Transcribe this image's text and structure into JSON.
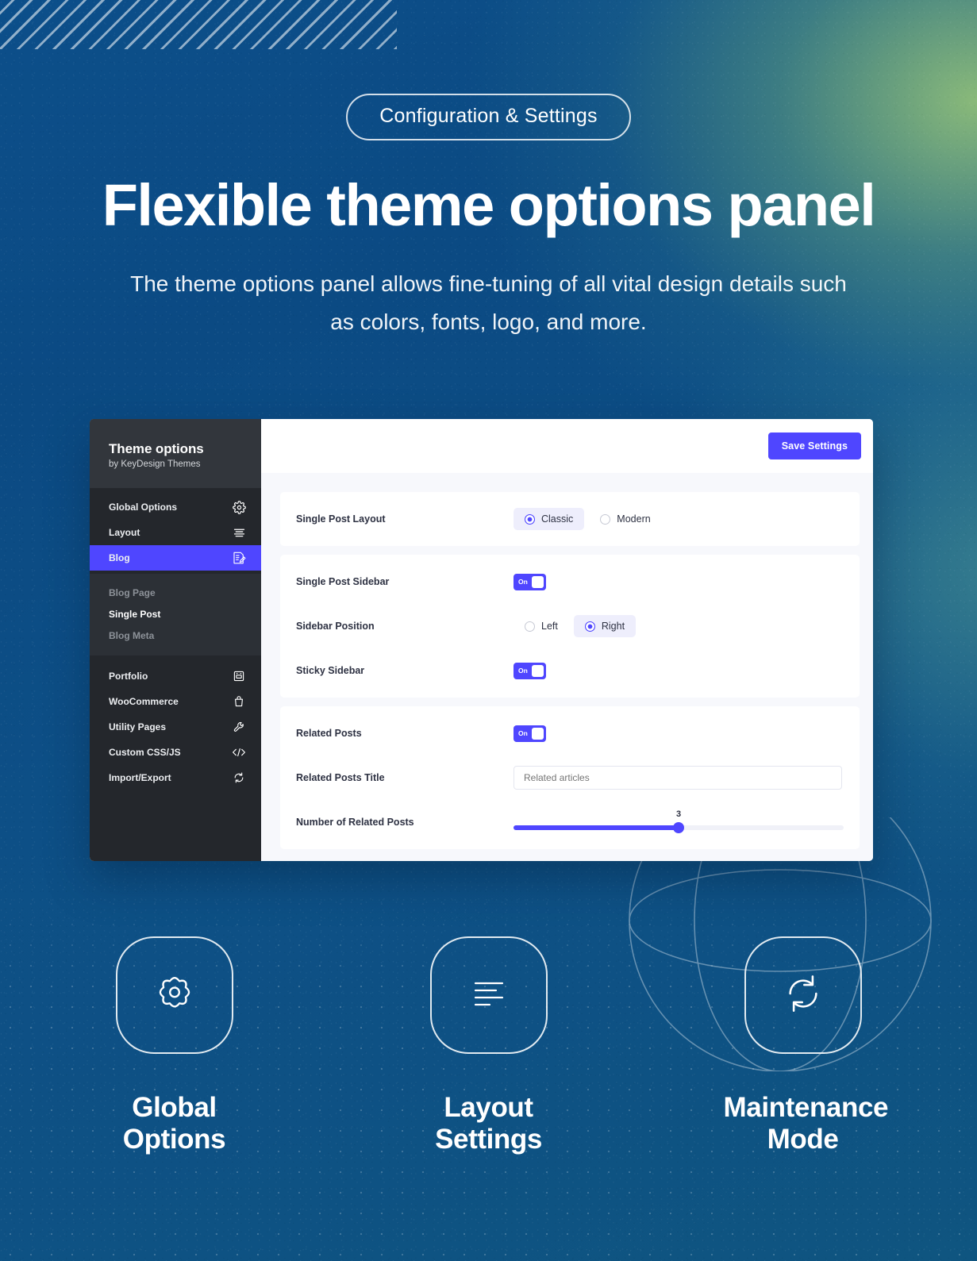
{
  "hero": {
    "badge": "Configuration & Settings",
    "headline": "Flexible theme options panel",
    "subhead": "The theme options panel allows fine-tuning of all vital design details such as colors, fonts, logo, and more."
  },
  "panel": {
    "sidebar": {
      "title": "Theme options",
      "subtitle": "by KeyDesign Themes",
      "primary_items": [
        {
          "label": "Global Options",
          "icon": "gear-icon",
          "active": false
        },
        {
          "label": "Layout",
          "icon": "align-lines-icon",
          "active": false
        },
        {
          "label": "Blog",
          "icon": "edit-document-icon",
          "active": true
        }
      ],
      "sub_items": [
        {
          "label": "Blog Page",
          "current": false
        },
        {
          "label": "Single Post",
          "current": true
        },
        {
          "label": "Blog Meta",
          "current": false
        }
      ],
      "secondary_items": [
        {
          "label": "Portfolio",
          "icon": "portfolio-grid-icon"
        },
        {
          "label": "WooCommerce",
          "icon": "shopping-bag-icon"
        },
        {
          "label": "Utility Pages",
          "icon": "wrench-icon"
        },
        {
          "label": "Custom CSS/JS",
          "icon": "code-brackets-icon"
        },
        {
          "label": "Import/Export",
          "icon": "sync-arrows-icon"
        }
      ],
      "active_color": "#4f46ff",
      "background": "#24272c",
      "header_background": "#32363c"
    },
    "toolbar": {
      "save_label": "Save Settings"
    },
    "settings": {
      "single_post_layout": {
        "label": "Single Post Layout",
        "options": [
          "Classic",
          "Modern"
        ],
        "selected": "Classic"
      },
      "single_post_sidebar": {
        "label": "Single Post Sidebar",
        "toggle_label": "On",
        "value": true
      },
      "sidebar_position": {
        "label": "Sidebar Position",
        "options": [
          "Left",
          "Right"
        ],
        "selected": "Right"
      },
      "sticky_sidebar": {
        "label": "Sticky Sidebar",
        "toggle_label": "On",
        "value": true
      },
      "related_posts": {
        "label": "Related Posts",
        "toggle_label": "On",
        "value": true
      },
      "related_posts_title": {
        "label": "Related Posts Title",
        "placeholder": "Related articles",
        "value": ""
      },
      "number_of_related_posts": {
        "label": "Number of Related Posts",
        "value": "3",
        "percent": 50
      }
    }
  },
  "features": [
    {
      "label": "Global\nOptions",
      "icon": "gear-outline-icon"
    },
    {
      "label": "Layout\nSettings",
      "icon": "align-left-outline-icon"
    },
    {
      "label": "Maintenance\nMode",
      "icon": "refresh-cycle-outline-icon"
    }
  ]
}
